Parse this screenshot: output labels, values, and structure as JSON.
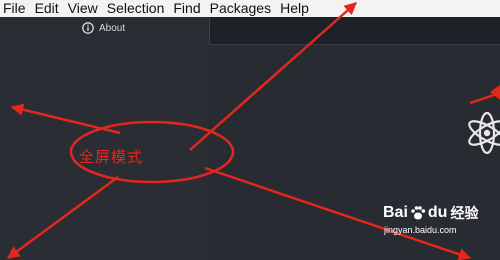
{
  "menubar": {
    "items": [
      "File",
      "Edit",
      "View",
      "Selection",
      "Find",
      "Packages",
      "Help"
    ]
  },
  "sidebar": {
    "about_label": "About",
    "about_icon": "info-circle-icon"
  },
  "annotation": {
    "callout_text": "全屏模式",
    "color": "#e4261c"
  },
  "logo": {
    "icon": "atom-logo-icon"
  },
  "watermark": {
    "brand_left": "Bai",
    "brand_right": "du",
    "brand_suffix": "经验",
    "url": "jingyan.baidu.com"
  },
  "colors": {
    "menubar_bg": "#f3f3f3",
    "editor_bg": "#23262d",
    "annotation": "#e4261c"
  }
}
